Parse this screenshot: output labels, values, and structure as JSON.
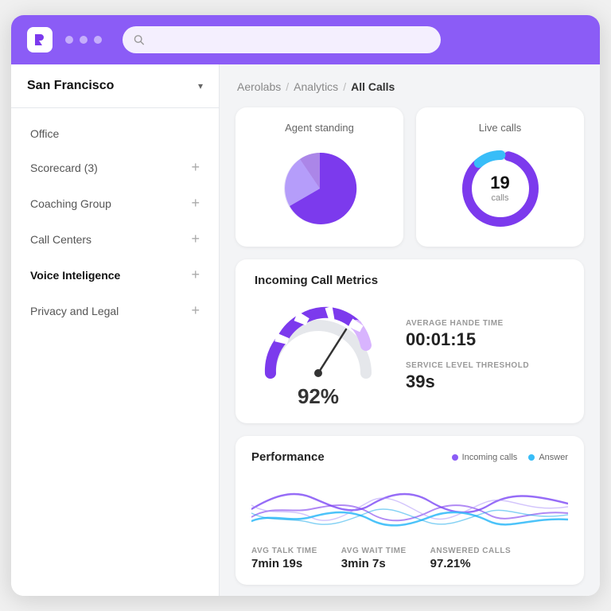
{
  "topbar": {
    "logo": "R",
    "dots": [
      "dot1",
      "dot2",
      "dot3"
    ],
    "search_placeholder": ""
  },
  "sidebar": {
    "location": "San Francisco",
    "items": [
      {
        "label": "Office",
        "has_plus": false
      },
      {
        "label": "Scorecard (3)",
        "has_plus": true
      },
      {
        "label": "Coaching Group",
        "has_plus": true
      },
      {
        "label": "Call Centers",
        "has_plus": true
      },
      {
        "label": "Voice Inteligence",
        "has_plus": true,
        "bold": true
      },
      {
        "label": "Privacy and Legal",
        "has_plus": true
      }
    ]
  },
  "breadcrumb": {
    "items": [
      "Aerolabs",
      "Analytics"
    ],
    "current": "All Calls",
    "separator": "/"
  },
  "agent_standing_card": {
    "title": "Agent standing"
  },
  "live_calls_card": {
    "title": "Live calls",
    "number": "19",
    "unit": "calls"
  },
  "incoming_metrics_card": {
    "title": "Incoming Call Metrics",
    "gauge_pct": "92%",
    "avg_handle_label": "AVERAGE HANDE TIME",
    "avg_handle_value": "00:01:15",
    "service_level_label": "SERVICE LEVEL THRESHOLD",
    "service_level_value": "39s"
  },
  "performance_card": {
    "title": "Performance",
    "legend": [
      {
        "label": "Incoming calls",
        "color": "#8b5cf6"
      },
      {
        "label": "Answer",
        "color": "#38bdf8"
      }
    ],
    "stats": [
      {
        "label": "AVG TALK TIME",
        "value": "7min 19s"
      },
      {
        "label": "AVG WAIT TIME",
        "value": "3min 7s"
      },
      {
        "label": "ANSWERED CALLS",
        "value": "97.21%"
      }
    ]
  },
  "colors": {
    "purple_main": "#7c3aed",
    "purple_light": "#a78bfa",
    "purple_mid": "#8b5cf6",
    "blue_accent": "#38bdf8",
    "gauge_purple": "#6d28d9"
  }
}
